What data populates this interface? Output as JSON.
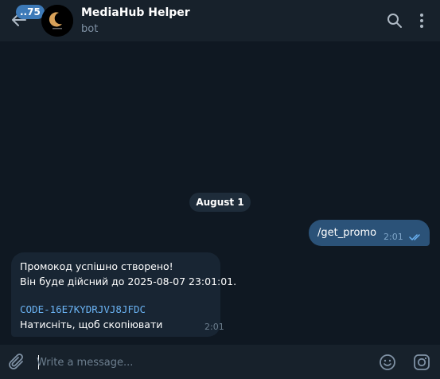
{
  "header": {
    "unread_count": "..75",
    "title": "MediaHub Helper",
    "subtitle": "bot"
  },
  "chat": {
    "date_separator": "August 1",
    "outgoing": {
      "text": "/get_promo",
      "time": "2:01"
    },
    "incoming": {
      "line1": "Промокод успішно створено!",
      "line2": "Він буде дійсний до 2025-08-07 23:01:01.",
      "code": "CODE-16E7KYDRJVJ8JFDC",
      "hint": "Натисніть, щоб скопіювати",
      "time": "2:01"
    }
  },
  "composer": {
    "placeholder": "Write a message..."
  },
  "colors": {
    "background": "#0f1822",
    "header": "#17212b",
    "outgoing_bubble": "#2b5278",
    "incoming_bubble": "#182533",
    "link": "#6ab2f2",
    "badge": "#3d7ab8"
  },
  "icons": [
    "back-arrow-icon",
    "search-icon",
    "more-vertical-icon",
    "paperclip-icon",
    "emoji-icon",
    "instagram-icon",
    "double-check-icon"
  ]
}
